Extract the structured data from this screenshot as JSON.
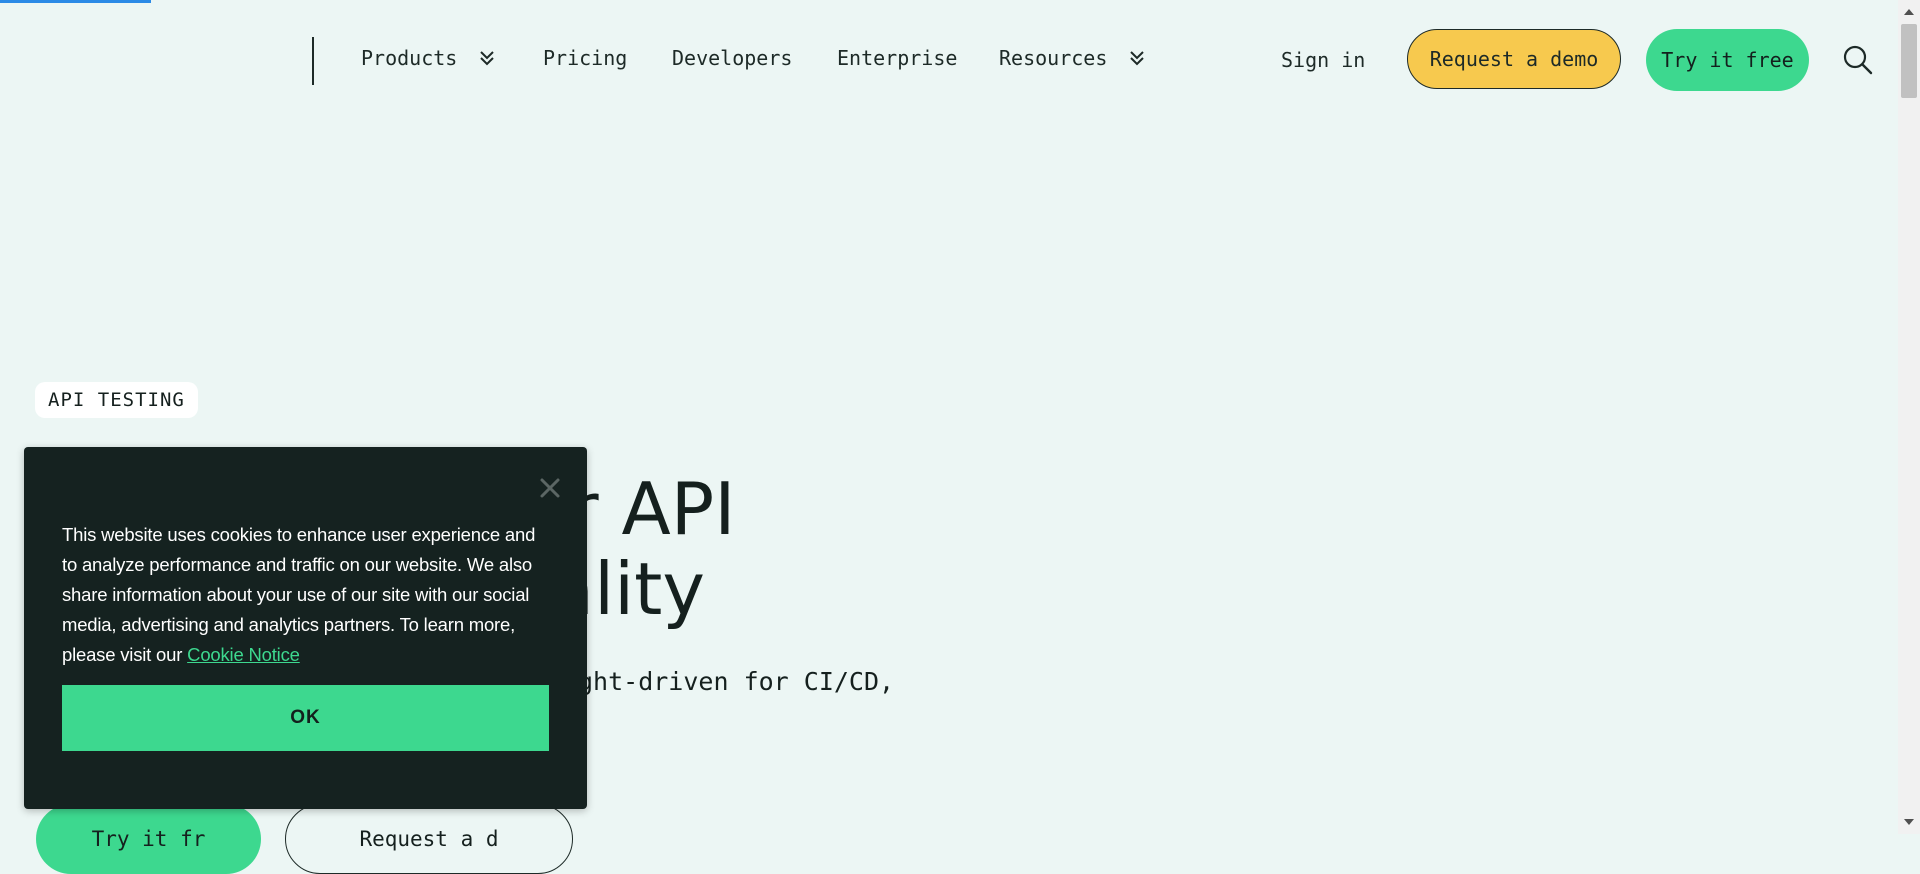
{
  "nav": {
    "items": [
      {
        "label": "Products",
        "dropdown": true
      },
      {
        "label": "Pricing"
      },
      {
        "label": "Developers"
      },
      {
        "label": "Enterprise"
      },
      {
        "label": "Resources",
        "dropdown": true
      }
    ],
    "sign_in": "Sign in",
    "request_demo": "Request a demo",
    "try_free": "Try it free",
    "search_icon": "search-icon"
  },
  "hero": {
    "eyebrow": "API TESTING",
    "title": "or API\nality",
    "subtitle": "ght-driven for CI/CD,",
    "cta_primary": "Try it fr",
    "cta_secondary": "Request a d"
  },
  "cookie": {
    "text": "This website uses cookies to enhance user experience and to analyze performance and traffic on our website. We also share information about your use of our site with our social media, advertising and analytics partners. To learn more, please visit our",
    "link": "Cookie Notice",
    "ok": "OK"
  },
  "colors": {
    "background": "#ecf6f4",
    "accent_green": "#3dd88f",
    "accent_yellow": "#f7c94e",
    "dark": "#152220"
  }
}
